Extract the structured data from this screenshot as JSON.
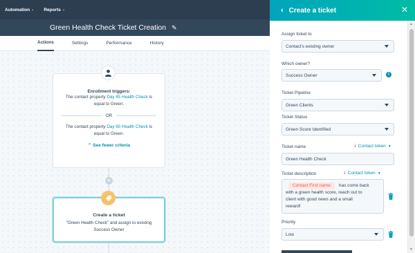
{
  "topnav": {
    "items": [
      {
        "label": "Automation"
      },
      {
        "label": "Reports"
      }
    ]
  },
  "workflow": {
    "title": "Green Health Check Ticket Creation"
  },
  "tabs": [
    {
      "label": "Actions",
      "active": true
    },
    {
      "label": "Settings"
    },
    {
      "label": "Performance"
    },
    {
      "label": "History"
    }
  ],
  "enrollment": {
    "heading": "Enrollment triggers:",
    "trigger1": {
      "prefix": "The contact property",
      "property": "Day 45 Health Check",
      "suffix": "is",
      "line2": "equal to Green."
    },
    "or_label": "OR",
    "trigger2": {
      "prefix": "The contact property",
      "property": "Day 90 Health Check",
      "suffix": "is",
      "line2": "equal to Green."
    },
    "fewer_link": "See fewer criteria"
  },
  "action_card": {
    "heading": "Create a ticket",
    "line1": "\"Green Health Check\" and assign to existing",
    "line2": "Success Owner"
  },
  "panel": {
    "title": "Create a ticket",
    "assign_label": "Assign ticket to",
    "assign_value": "Contact's existing owner",
    "owner_label": "Which owner?",
    "owner_value": "Success Owner",
    "pipeline_label": "Ticket Pipeline",
    "pipeline_value": "Green Clients",
    "status_label": "Ticket Status",
    "status_value": "Green Score Identified",
    "name_label": "Ticket name",
    "token_label": "Contact token",
    "name_value": "Green Health Check",
    "desc_label": "Ticket description",
    "desc_token_label": "Contact token",
    "desc_chip": "Contact First name",
    "desc_text1": "has come back",
    "desc_text2": "with a green health score, reach out to",
    "desc_text3": "client with good news and a small",
    "desc_text4": "reward!",
    "priority_label": "Priority",
    "priority_value": "Low"
  },
  "colors": {
    "nav_bg": "#2d3e50",
    "title_bg": "#33475b",
    "accent": "#00a4bd",
    "link": "#0091ae",
    "chip_bg": "#fde8e2",
    "chip_text": "#f2545b",
    "badge_orange": "#f5c26b"
  }
}
